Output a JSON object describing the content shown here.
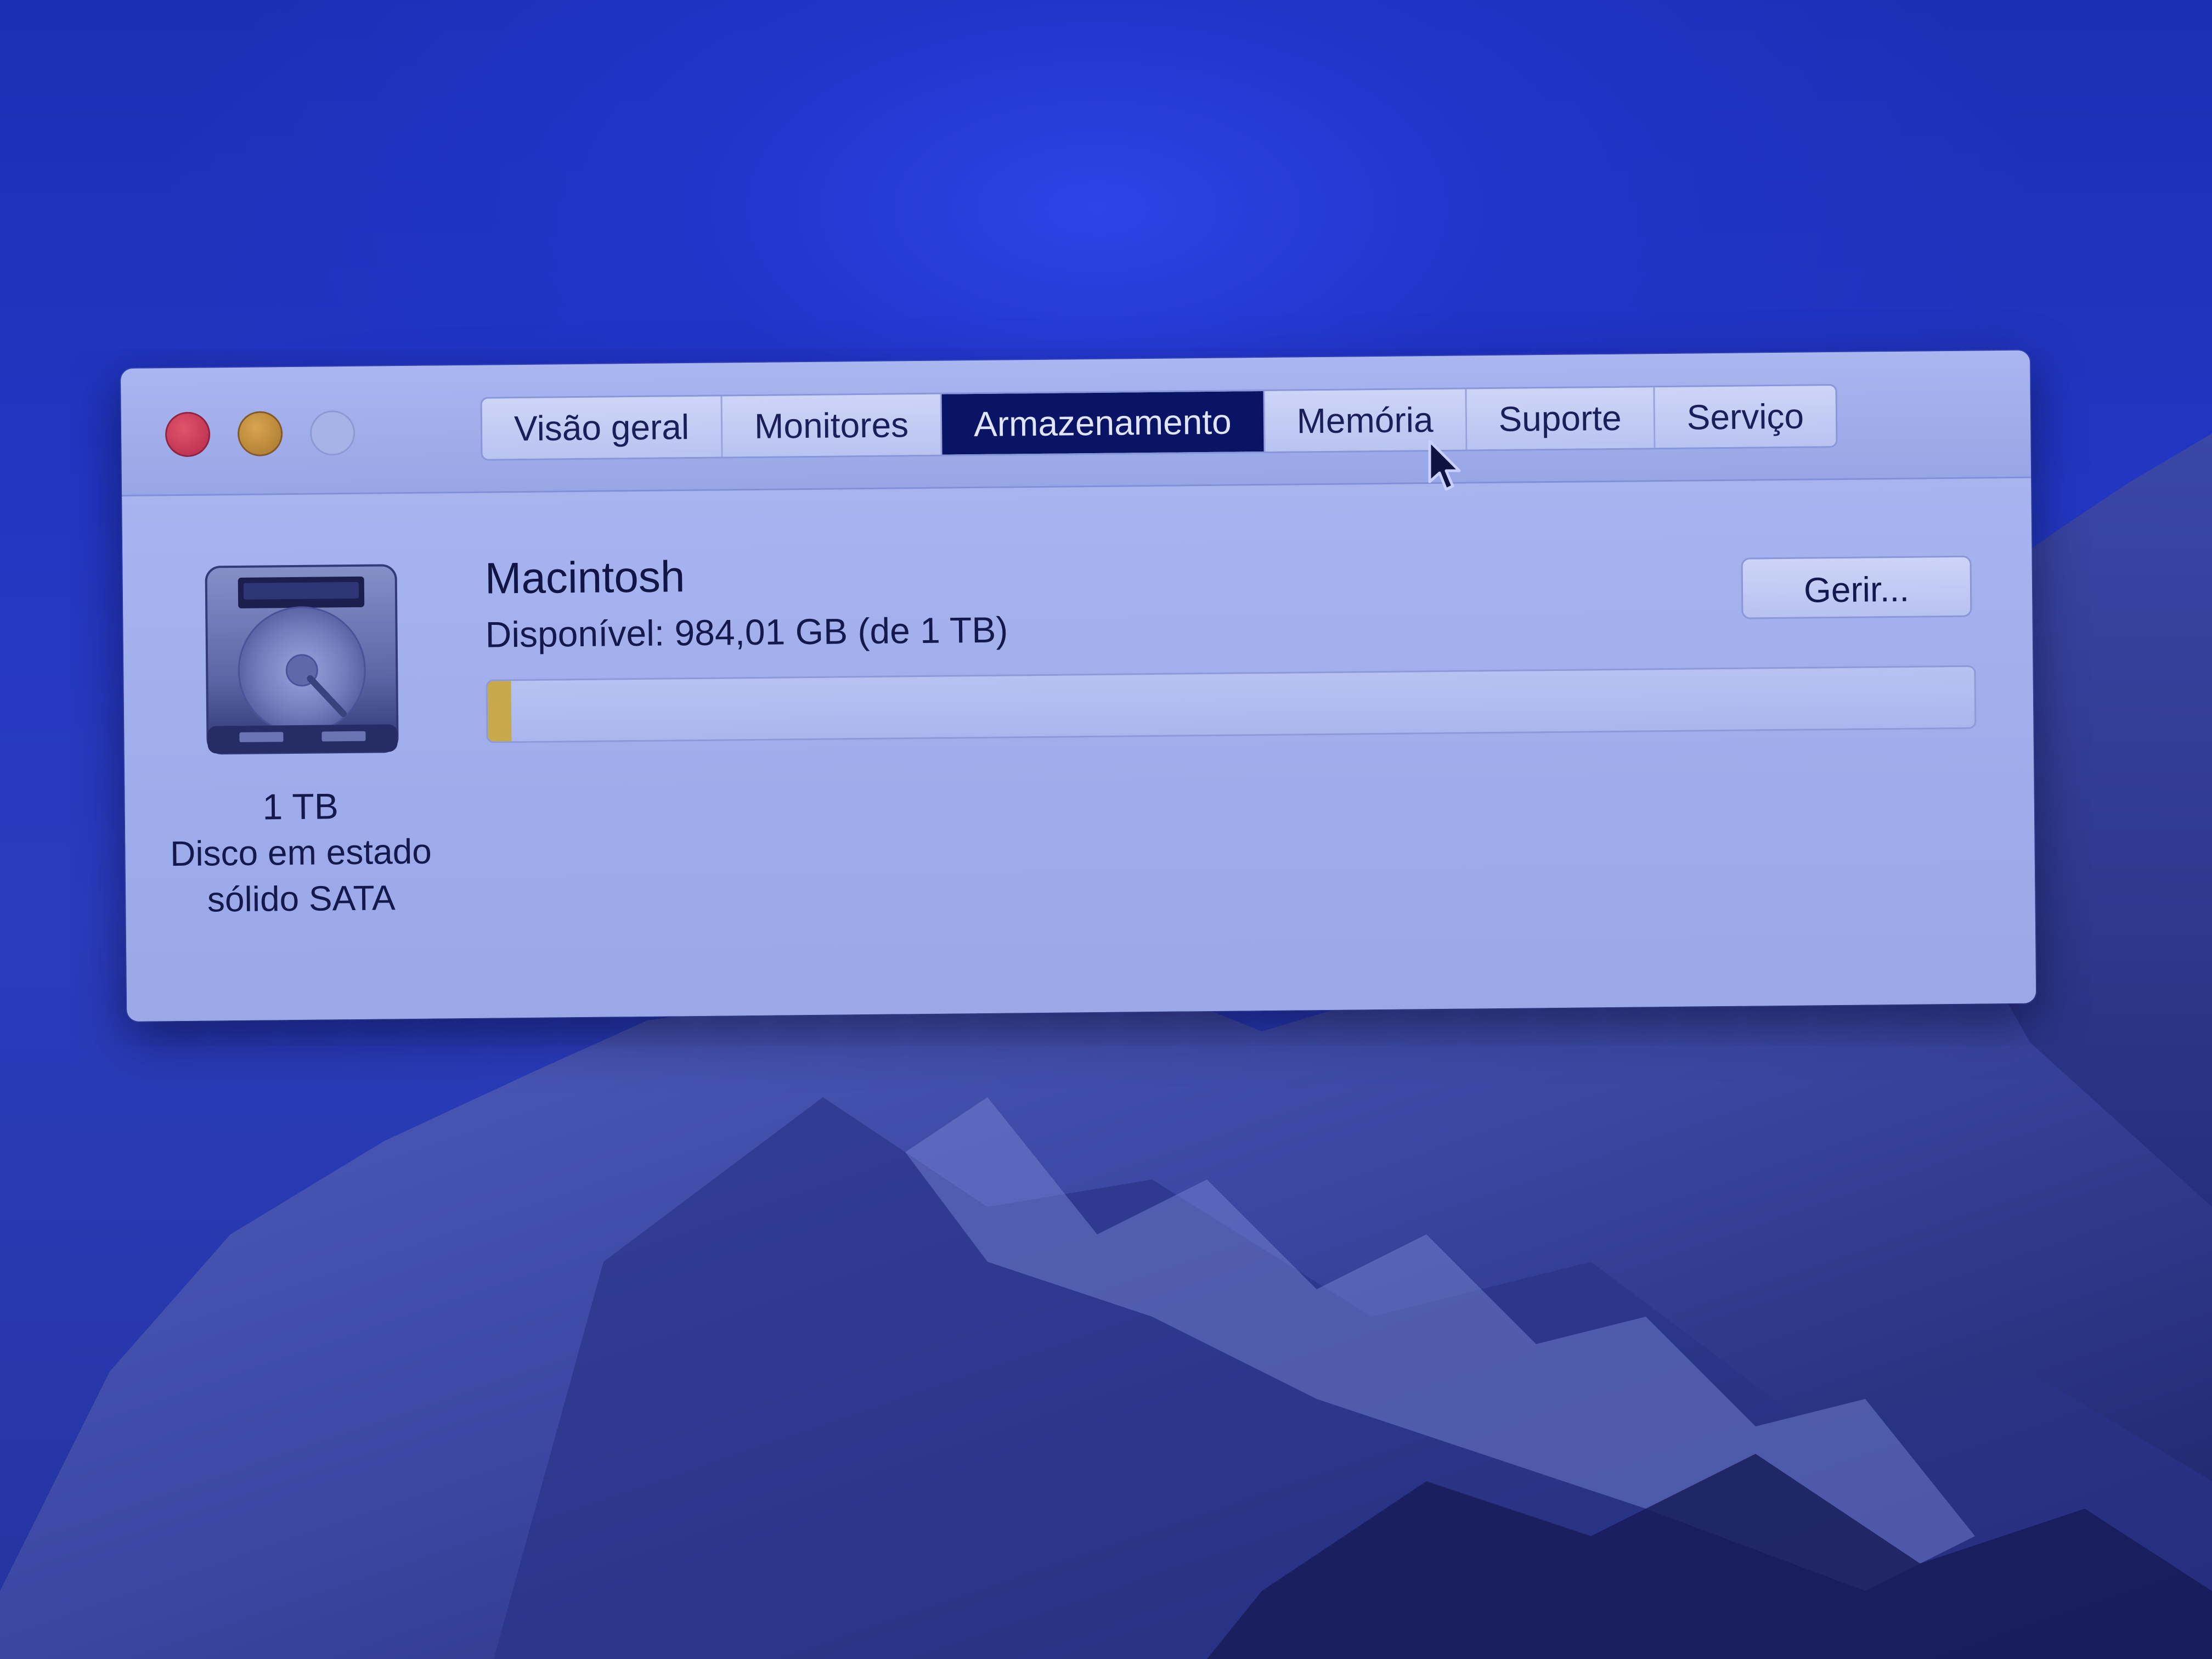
{
  "window": {
    "tabs": [
      {
        "label": "Visão geral",
        "active": false
      },
      {
        "label": "Monitores",
        "active": false
      },
      {
        "label": "Armazenamento",
        "active": true
      },
      {
        "label": "Memória",
        "active": false
      },
      {
        "label": "Suporte",
        "active": false
      },
      {
        "label": "Serviço",
        "active": false
      }
    ]
  },
  "disk": {
    "size": "1 TB",
    "type": "Disco em estado sólido SATA",
    "icon": "hard-drive-icon"
  },
  "volume": {
    "name": "Macintosh",
    "available": "Disponível: 984,01 GB (de 1 TB)",
    "used_fraction": 0.016,
    "manage_label": "Gerir..."
  },
  "colors": {
    "active_tab": "#0a1464",
    "used_segment": "#c7a84a"
  }
}
